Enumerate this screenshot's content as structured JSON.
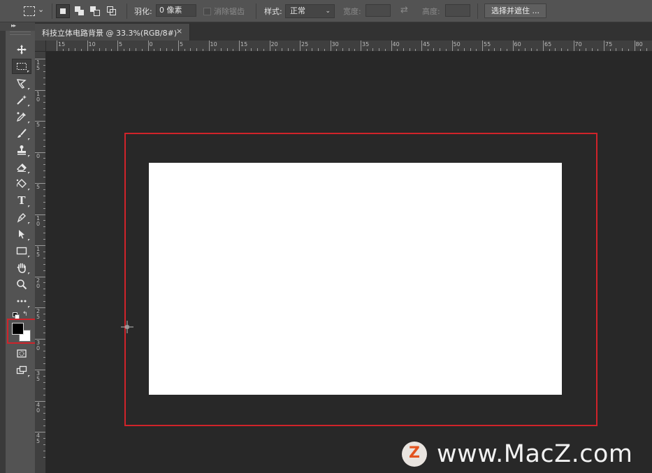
{
  "options_bar": {
    "feather_label": "羽化:",
    "feather_value": "0 像素",
    "antialias_label": "消除锯齿",
    "style_label": "样式:",
    "style_value": "正常",
    "width_label": "宽度:",
    "height_label": "高度:",
    "select_mask_button": "选择并遮住 ..."
  },
  "document": {
    "tab_title": "科技立体电路背景 @ 33.3%(RGB/8#)",
    "close_glyph": "×"
  },
  "ruler_h_labels": [
    "15",
    "10",
    "5",
    "0",
    "5",
    "10",
    "15",
    "20",
    "25",
    "30",
    "35",
    "40",
    "45",
    "50",
    "55",
    "60",
    "65",
    "70",
    "75",
    "80"
  ],
  "ruler_v_labels": [
    "1\n5",
    "1\n0",
    "5",
    "0",
    "5",
    "1\n0",
    "1\n5",
    "2\n0",
    "2\n5",
    "3\n0",
    "3\n5",
    "4\n0",
    "4\n5"
  ],
  "tools": [
    {
      "name": "move-tool",
      "icon": "move-icon"
    },
    {
      "name": "rectangular-marquee-tool",
      "icon": "marquee-icon",
      "active": true
    },
    {
      "name": "lasso-tool",
      "icon": "lasso-icon"
    },
    {
      "name": "magic-wand-tool",
      "icon": "magic-wand-icon"
    },
    {
      "name": "eyedropper-tool",
      "icon": "eyedropper-icon"
    },
    {
      "name": "brush-tool",
      "icon": "brush-icon"
    },
    {
      "name": "clone-stamp-tool",
      "icon": "stamp-icon"
    },
    {
      "name": "eraser-tool",
      "icon": "eraser-icon"
    },
    {
      "name": "paint-bucket-tool",
      "icon": "paint-bucket-icon"
    },
    {
      "name": "type-tool",
      "icon": "type-icon",
      "glyph": "T"
    },
    {
      "name": "pen-tool",
      "icon": "pen-icon"
    },
    {
      "name": "path-selection-tool",
      "icon": "arrow-icon"
    },
    {
      "name": "rectangle-tool",
      "icon": "rectangle-icon"
    },
    {
      "name": "hand-tool",
      "icon": "hand-icon"
    },
    {
      "name": "zoom-tool",
      "icon": "zoom-icon"
    },
    {
      "name": "more-tools",
      "icon": "ellipsis-icon"
    }
  ],
  "colors": {
    "foreground": "#000000",
    "background": "#ffffff",
    "highlight": "#d0232a"
  },
  "watermark": {
    "logo_letter": "Z",
    "text": "www.MacZ.com"
  }
}
